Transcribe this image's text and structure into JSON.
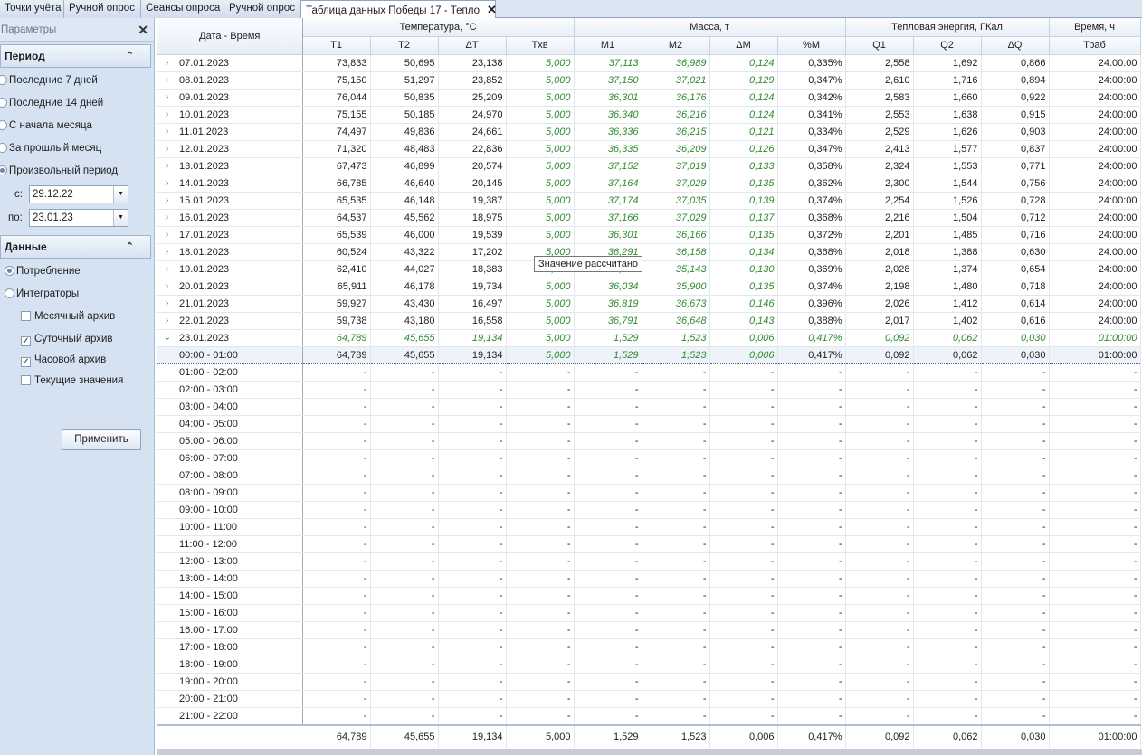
{
  "tabs": [
    {
      "label": "Точки учёта"
    },
    {
      "label": "Ручной опрос"
    },
    {
      "label": "Сеансы опроса"
    },
    {
      "label": "Ручной опрос"
    },
    {
      "label": "Таблица данных Победы 17 - Тепло",
      "close": "✕"
    }
  ],
  "sidebar": {
    "title": "Параметры",
    "close": "✕",
    "period_group": "Период",
    "periods": [
      "Последние 7 дней",
      "Последние 14 дней",
      "С начала месяца",
      "За прошлый месяц",
      "Произвольный период"
    ],
    "from_label": "с:",
    "from_value": "29.12.22",
    "to_label": "по:",
    "to_value": "23.01.23",
    "data_group": "Данные",
    "data_modes": [
      "Потребление",
      "Интеграторы"
    ],
    "archives": [
      "Месячный архив",
      "Суточный архив",
      "Часовой архив",
      "Текущие значения"
    ],
    "archives_checked": [
      false,
      true,
      true,
      false
    ],
    "apply": "Применить"
  },
  "grid": {
    "date_header": "Дата - Время",
    "groups": [
      "Температура, °С",
      "Масса, т",
      "Тепловая энергия, ГКал",
      "Время, ч"
    ],
    "columns": [
      "T1",
      "T2",
      "ΔT",
      "Tхв",
      "M1",
      "M2",
      "ΔM",
      "%M",
      "Q1",
      "Q2",
      "ΔQ",
      "Траб"
    ],
    "daily": [
      [
        "07.01.2023",
        "73,833",
        "50,695",
        "23,138",
        "5,000",
        "37,113",
        "36,989",
        "0,124",
        "0,335%",
        "2,558",
        "1,692",
        "0,866",
        "24:00:00"
      ],
      [
        "08.01.2023",
        "75,150",
        "51,297",
        "23,852",
        "5,000",
        "37,150",
        "37,021",
        "0,129",
        "0,347%",
        "2,610",
        "1,716",
        "0,894",
        "24:00:00"
      ],
      [
        "09.01.2023",
        "76,044",
        "50,835",
        "25,209",
        "5,000",
        "36,301",
        "36,176",
        "0,124",
        "0,342%",
        "2,583",
        "1,660",
        "0,922",
        "24:00:00"
      ],
      [
        "10.01.2023",
        "75,155",
        "50,185",
        "24,970",
        "5,000",
        "36,340",
        "36,216",
        "0,124",
        "0,341%",
        "2,553",
        "1,638",
        "0,915",
        "24:00:00"
      ],
      [
        "11.01.2023",
        "74,497",
        "49,836",
        "24,661",
        "5,000",
        "36,336",
        "36,215",
        "0,121",
        "0,334%",
        "2,529",
        "1,626",
        "0,903",
        "24:00:00"
      ],
      [
        "12.01.2023",
        "71,320",
        "48,483",
        "22,836",
        "5,000",
        "36,335",
        "36,209",
        "0,126",
        "0,347%",
        "2,413",
        "1,577",
        "0,837",
        "24:00:00"
      ],
      [
        "13.01.2023",
        "67,473",
        "46,899",
        "20,574",
        "5,000",
        "37,152",
        "37,019",
        "0,133",
        "0,358%",
        "2,324",
        "1,553",
        "0,771",
        "24:00:00"
      ],
      [
        "14.01.2023",
        "66,785",
        "46,640",
        "20,145",
        "5,000",
        "37,164",
        "37,029",
        "0,135",
        "0,362%",
        "2,300",
        "1,544",
        "0,756",
        "24:00:00"
      ],
      [
        "15.01.2023",
        "65,535",
        "46,148",
        "19,387",
        "5,000",
        "37,174",
        "37,035",
        "0,139",
        "0,374%",
        "2,254",
        "1,526",
        "0,728",
        "24:00:00"
      ],
      [
        "16.01.2023",
        "64,537",
        "45,562",
        "18,975",
        "5,000",
        "37,166",
        "37,029",
        "0,137",
        "0,368%",
        "2,216",
        "1,504",
        "0,712",
        "24:00:00"
      ],
      [
        "17.01.2023",
        "65,539",
        "46,000",
        "19,539",
        "5,000",
        "36,301",
        "36,166",
        "0,135",
        "0,372%",
        "2,201",
        "1,485",
        "0,716",
        "24:00:00"
      ],
      [
        "18.01.2023",
        "60,524",
        "43,322",
        "17,202",
        "5,000",
        "36,291",
        "36,158",
        "0,134",
        "0,368%",
        "2,018",
        "1,388",
        "0,630",
        "24:00:00"
      ],
      [
        "19.01.2023",
        "62,410",
        "44,027",
        "18,383",
        "5,000",
        "35,271",
        "35,143",
        "0,130",
        "0,369%",
        "2,028",
        "1,374",
        "0,654",
        "24:00:00"
      ],
      [
        "20.01.2023",
        "65,911",
        "46,178",
        "19,734",
        "5,000",
        "36,034",
        "35,900",
        "0,135",
        "0,374%",
        "2,198",
        "1,480",
        "0,718",
        "24:00:00"
      ],
      [
        "21.01.2023",
        "59,927",
        "43,430",
        "16,497",
        "5,000",
        "36,819",
        "36,673",
        "0,146",
        "0,396%",
        "2,026",
        "1,412",
        "0,614",
        "24:00:00"
      ],
      [
        "22.01.2023",
        "59,738",
        "43,180",
        "16,558",
        "5,000",
        "36,791",
        "36,648",
        "0,143",
        "0,388%",
        "2,017",
        "1,402",
        "0,616",
        "24:00:00"
      ]
    ],
    "current": [
      "23.01.2023",
      "64,789",
      "45,655",
      "19,134",
      "5,000",
      "1,529",
      "1,523",
      "0,006",
      "0,417%",
      "0,092",
      "0,062",
      "0,030",
      "01:00:00"
    ],
    "hour_selected": [
      "00:00 - 01:00",
      "64,789",
      "45,655",
      "19,134",
      "5,000",
      "1,529",
      "1,523",
      "0,006",
      "0,417%",
      "0,092",
      "0,062",
      "0,030",
      "01:00:00"
    ],
    "hours_empty": [
      "01:00 - 02:00",
      "02:00 - 03:00",
      "03:00 - 04:00",
      "04:00 - 05:00",
      "05:00 - 06:00",
      "06:00 - 07:00",
      "07:00 - 08:00",
      "08:00 - 09:00",
      "09:00 - 10:00",
      "10:00 - 11:00",
      "11:00 - 12:00",
      "12:00 - 13:00",
      "13:00 - 14:00",
      "14:00 - 15:00",
      "15:00 - 16:00",
      "16:00 - 17:00",
      "17:00 - 18:00",
      "18:00 - 19:00",
      "19:00 - 20:00",
      "20:00 - 21:00",
      "21:00 - 22:00"
    ],
    "empty_value": "-",
    "totals": [
      "64,789",
      "45,655",
      "19,134",
      "5,000",
      "1,529",
      "1,523",
      "0,006",
      "0,417%",
      "0,092",
      "0,062",
      "0,030",
      "01:00:00"
    ],
    "expand_icon": "›",
    "collapse_icon": "⌄"
  },
  "tooltip": "Значение рассчитано",
  "colors": {
    "calculated": "#2e8b2e",
    "panel": "#d5e2f1"
  }
}
